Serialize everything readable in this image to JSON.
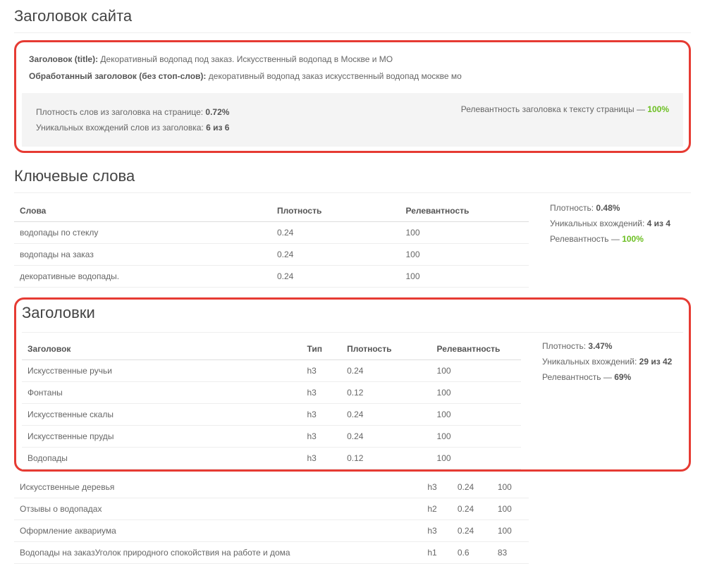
{
  "siteTitle": {
    "heading": "Заголовок сайта",
    "titleLabel": "Заголовок (title):",
    "titleValue": "Декоративный водопад под заказ. Искусственный водопад в Москве и МО",
    "processedLabel": "Обработанный заголовок (без стоп-слов):",
    "processedValue": "декоративный водопад заказ искусственный водопад москве мо",
    "densityLabel": "Плотность слов из заголовка на странице:",
    "densityValue": "0.72%",
    "uniqueLabel": "Уникальных вхождений слов из заголовка:",
    "uniqueValue": "6 из 6",
    "relevanceLabel": "Релевантность заголовка к тексту страницы —",
    "relevanceValue": "100%"
  },
  "keywords": {
    "heading": "Ключевые слова",
    "cols": {
      "word": "Слова",
      "density": "Плотность",
      "relevance": "Релевантность"
    },
    "rows": [
      {
        "word": "водопады по стеклу",
        "density": "0.24",
        "relevance": "100"
      },
      {
        "word": "водопады на заказ",
        "density": "0.24",
        "relevance": "100"
      },
      {
        "word": "декоративные водопады.",
        "density": "0.24",
        "relevance": "100"
      }
    ],
    "side": {
      "densityLabel": "Плотность:",
      "densityValue": "0.48%",
      "uniqueLabel": "Уникальных вхождений:",
      "uniqueValue": "4 из 4",
      "relevanceLabel": "Релевантность —",
      "relevanceValue": "100%"
    }
  },
  "headings": {
    "heading": "Заголовки",
    "cols": {
      "title": "Заголовок",
      "type": "Тип",
      "density": "Плотность",
      "relevance": "Релевантность"
    },
    "rows": [
      {
        "title": "Искусственные ручьи",
        "type": "h3",
        "density": "0.24",
        "relevance": "100"
      },
      {
        "title": "Фонтаны",
        "type": "h3",
        "density": "0.12",
        "relevance": "100"
      },
      {
        "title": "Искусственные скалы",
        "type": "h3",
        "density": "0.24",
        "relevance": "100"
      },
      {
        "title": "Искусственные пруды",
        "type": "h3",
        "density": "0.24",
        "relevance": "100"
      },
      {
        "title": "Водопады",
        "type": "h3",
        "density": "0.12",
        "relevance": "100"
      },
      {
        "title": "Искусственные деревья",
        "type": "h3",
        "density": "0.24",
        "relevance": "100"
      },
      {
        "title": "Отзывы о водопадах",
        "type": "h2",
        "density": "0.24",
        "relevance": "100"
      },
      {
        "title": "Оформление аквариума",
        "type": "h3",
        "density": "0.24",
        "relevance": "100"
      },
      {
        "title": "Водопады на заказУголок природного спокойствия на работе и дома",
        "type": "h1",
        "density": "0.6",
        "relevance": "83"
      }
    ],
    "side": {
      "densityLabel": "Плотность:",
      "densityValue": "3.47%",
      "uniqueLabel": "Уникальных вхождений:",
      "uniqueValue": "29 из 42",
      "relevanceLabel": "Релевантность —",
      "relevanceValue": "69%"
    }
  }
}
